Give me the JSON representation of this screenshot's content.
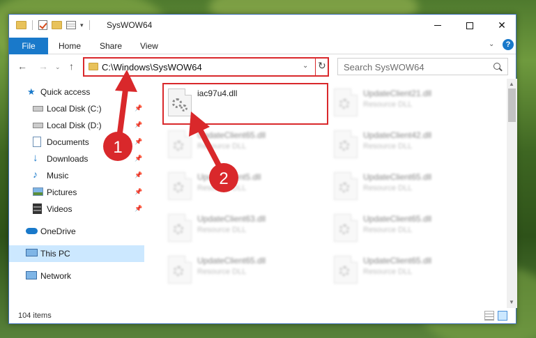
{
  "window": {
    "title": "SysWOW64",
    "qat_arrow": "▾",
    "minimize_label": "",
    "close_glyph": "✕"
  },
  "ribbon": {
    "tabs": [
      "File",
      "Home",
      "Share",
      "View"
    ],
    "expand_glyph": "⌄",
    "help_glyph": "?"
  },
  "nav": {
    "back_glyph": "←",
    "forward_glyph": "→",
    "recent_glyph": "⌄",
    "up_glyph": "↑",
    "address": "C:\\Windows\\SysWOW64",
    "dropdown_glyph": "⌄",
    "refresh_glyph": "↻",
    "search_placeholder": "Search SysWOW64"
  },
  "sidebar": {
    "items": [
      {
        "label": "Quick access",
        "icon": "star-icon",
        "pinned": false
      },
      {
        "label": "Local Disk (C:)",
        "icon": "drive-icon",
        "pinned": true
      },
      {
        "label": "Local Disk (D:)",
        "icon": "drive-icon",
        "pinned": true
      },
      {
        "label": "Documents",
        "icon": "documents-icon",
        "pinned": true
      },
      {
        "label": "Downloads",
        "icon": "downloads-icon",
        "pinned": true
      },
      {
        "label": "Music",
        "icon": "music-icon",
        "pinned": true
      },
      {
        "label": "Pictures",
        "icon": "pictures-icon",
        "pinned": true
      },
      {
        "label": "Videos",
        "icon": "videos-icon",
        "pinned": true
      },
      {
        "label": "OneDrive",
        "icon": "cloud-icon",
        "pinned": false
      },
      {
        "label": "This PC",
        "icon": "computer-icon",
        "pinned": false,
        "selected": true
      },
      {
        "label": "Network",
        "icon": "network-icon",
        "pinned": false
      }
    ],
    "pin_glyph": "📌"
  },
  "files": [
    {
      "name": "iac97u4.dll",
      "type": "",
      "highlighted": true
    },
    {
      "name": "UpdateClient21.dll",
      "type": "Resource DLL"
    },
    {
      "name": "UpdateClient65.dll",
      "type": "Resource DLL"
    },
    {
      "name": "UpdateClient42.dll",
      "type": "Resource DLL"
    },
    {
      "name": "UpdateClient5.dll",
      "type": "Resource DLL"
    },
    {
      "name": "UpdateClient65.dll",
      "type": "Resource DLL"
    },
    {
      "name": "UpdateClient63.dll",
      "type": "Resource DLL"
    },
    {
      "name": "UpdateClient65.dll",
      "type": "Resource DLL"
    },
    {
      "name": "UpdateClient65.dll",
      "type": "Resource DLL"
    },
    {
      "name": "UpdateClient65.dll",
      "type": "Resource DLL"
    }
  ],
  "status": {
    "item_count": "104 items"
  },
  "annotations": {
    "step1": "1",
    "step2": "2",
    "color": "#d9282b"
  },
  "colors": {
    "accent": "#1979ca",
    "highlight_border": "#d9282b",
    "selection": "#cce8ff"
  }
}
